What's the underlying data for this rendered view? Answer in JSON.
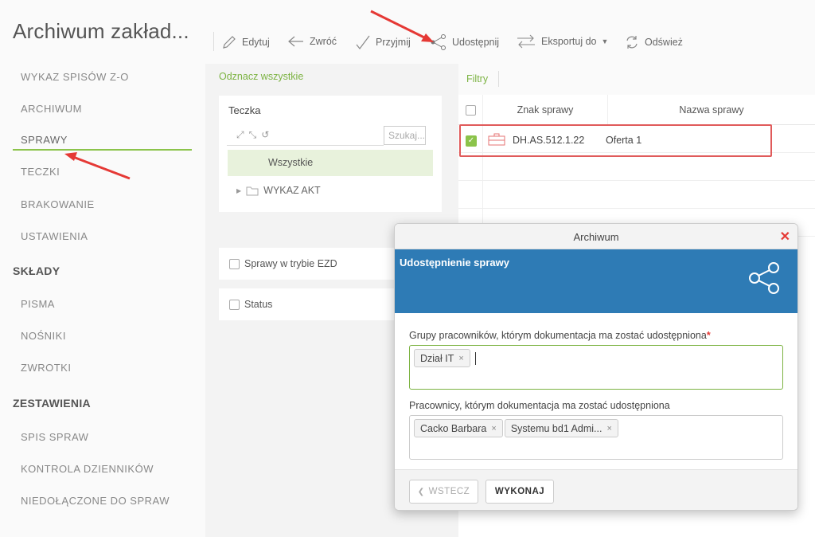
{
  "app": {
    "title": "Archiwum zakład..."
  },
  "sidebar": {
    "items": [
      {
        "label": "WYKAZ SPISÓW Z-O"
      },
      {
        "label": "ARCHIWUM"
      },
      {
        "label": "SPRAWY",
        "active": true
      },
      {
        "label": "TECZKI"
      },
      {
        "label": "BRAKOWANIE"
      },
      {
        "label": "USTAWIENIA"
      }
    ],
    "sections": [
      {
        "label": "SKŁADY",
        "items": [
          {
            "label": "PISMA"
          },
          {
            "label": "NOŚNIKI"
          },
          {
            "label": "ZWROTKI"
          }
        ]
      },
      {
        "label": "ZESTAWIENIA",
        "items": [
          {
            "label": "SPIS SPRAW"
          },
          {
            "label": "KONTROLA DZIENNIKÓW"
          },
          {
            "label": "NIEDOŁĄCZONE DO SPRAW"
          }
        ]
      }
    ]
  },
  "toolbar": {
    "edit": "Edytuj",
    "return": "Zwróć",
    "accept": "Przyjmij",
    "share": "Udostępnij",
    "export": "Eksportuj do",
    "refresh": "Odśwież"
  },
  "tree": {
    "select_all": "Odznacz wszystkie",
    "title": "Teczka",
    "search_placeholder": "Szukaj...",
    "all_label": "Wszystkie",
    "node_label": "WYKAZ AKT"
  },
  "filters": {
    "ezd_label": "Sprawy w trybie EZD",
    "status_label": "Status"
  },
  "grid": {
    "filters_label": "Filtry",
    "columns": {
      "sig": "Znak sprawy",
      "name": "Nazwa sprawy"
    },
    "rows": [
      {
        "checked": true,
        "sig": "DH.AS.512.1.22",
        "name": "Oferta 1"
      }
    ]
  },
  "dialog": {
    "window_title": "Archiwum",
    "heading": "Udostępnienie sprawy",
    "groups_label": "Grupy pracowników, którym dokumentacja ma zostać udostępniona",
    "groups_required_mark": "*",
    "groups": [
      "Dział IT"
    ],
    "employees_label": "Pracownicy, którym dokumentacja ma zostać udostępniona",
    "employees": [
      "Cacko Barbara",
      "Systemu bd1 Admi..."
    ],
    "back_button": "WSTECZ",
    "execute_button": "WYKONAJ",
    "tag_remove": "×"
  },
  "colors": {
    "accent_green": "#8bc34a",
    "dialog_banner": "#2e7bb5",
    "highlight_red": "#e05a5a"
  }
}
